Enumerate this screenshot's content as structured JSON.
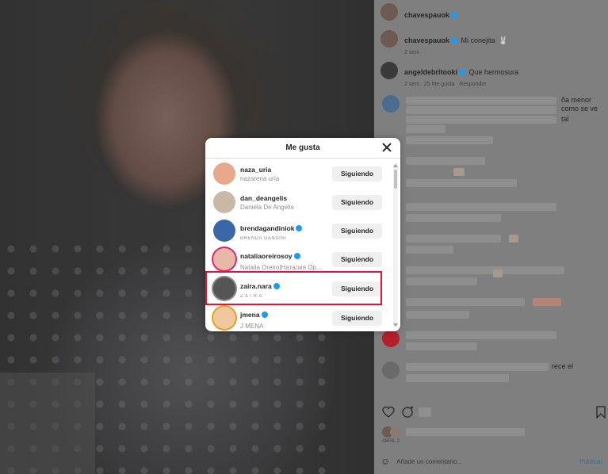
{
  "post": {
    "author": "chavespauok",
    "caption": "Mi conejita",
    "caption_emoji": "🐰",
    "caption_age": "2 sem"
  },
  "comments": [
    {
      "user": "angeldebritooki",
      "text": "Que hermosura",
      "age": "2 sem",
      "likes": "25 Me gusta",
      "reply": "Responder"
    }
  ],
  "comment_fragments": {
    "frag1": "ña menor",
    "frag2": "como se ve",
    "frag3": "tal",
    "frag4": "rece el"
  },
  "actions": {
    "date": "ABRIL 2"
  },
  "add_comment": {
    "placeholder": "Añade un comentario...",
    "publish": "Publicar"
  },
  "likes_modal": {
    "title": "Me gusta",
    "users": [
      {
        "handle": "naza_uria",
        "name": "nazarena uría",
        "verified": false,
        "button": "Siguiendo",
        "avatar_color": "#e8a98a"
      },
      {
        "handle": "dan_deangelis",
        "name": "Daniela De Angelis",
        "verified": false,
        "button": "Siguiendo",
        "avatar_color": "#c9b8a5"
      },
      {
        "handle": "brendagandiniok",
        "name": "BRENDA GANDINI",
        "verified": true,
        "button": "Siguiendo",
        "avatar_color": "#3a67a8"
      },
      {
        "handle": "nataliaoreirosoy",
        "name": "Natalia Oreiro|Наталия Op...",
        "verified": true,
        "button": "Siguiendo",
        "avatar_color": "#e7b7a8"
      },
      {
        "handle": "zaira.nara",
        "name": "Z A I R A",
        "verified": true,
        "button": "Siguiendo",
        "avatar_color": "#555555"
      },
      {
        "handle": "jmena",
        "name": "J MENA",
        "verified": true,
        "button": "Siguiendo",
        "avatar_color": "#f0c8a0"
      }
    ]
  },
  "colors": {
    "highlight": "#e0182d",
    "verified": "#1d9bf0",
    "button_bg": "#efefef"
  }
}
